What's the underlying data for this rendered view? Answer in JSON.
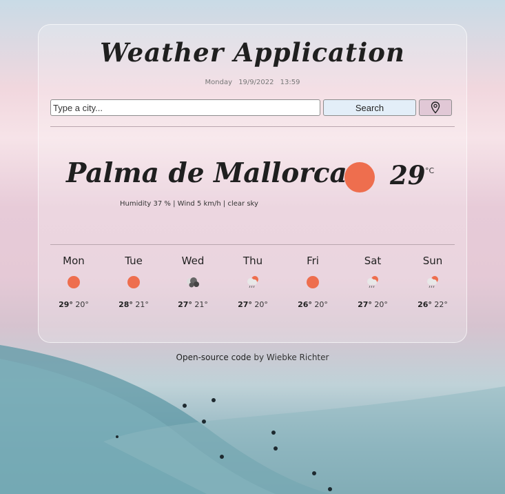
{
  "header": {
    "title": "Weather Application",
    "day": "Monday",
    "date": "19/9/2022",
    "time": "13:59"
  },
  "search": {
    "placeholder": "Type a city...",
    "button_label": "Search",
    "location_icon": "map-pin-icon"
  },
  "current": {
    "city": "Palma de Mallorca",
    "details": "Humidity 37 % | Wind 5 km/h | clear sky",
    "temperature": "29",
    "unit": "°C",
    "icon": "sun-icon"
  },
  "forecast": [
    {
      "day": "Mon",
      "high": "29°",
      "low": "20°",
      "icon": "sun-icon"
    },
    {
      "day": "Tue",
      "high": "28°",
      "low": "21°",
      "icon": "sun-icon"
    },
    {
      "day": "Wed",
      "high": "27°",
      "low": "21°",
      "icon": "clouds-icon"
    },
    {
      "day": "Thu",
      "high": "27°",
      "low": "20°",
      "icon": "rain-icon"
    },
    {
      "day": "Fri",
      "high": "26°",
      "low": "20°",
      "icon": "sun-icon"
    },
    {
      "day": "Sat",
      "high": "27°",
      "low": "20°",
      "icon": "rain-icon"
    },
    {
      "day": "Sun",
      "high": "26°",
      "low": "22°",
      "icon": "rain-icon"
    }
  ],
  "footer": {
    "link_text": "Open-source code",
    "by_text": "by Wiebke Richter"
  },
  "colors": {
    "sun": "#ee6e4e",
    "search_button": "#e3eef8",
    "location_button": "#e1c8d6"
  }
}
